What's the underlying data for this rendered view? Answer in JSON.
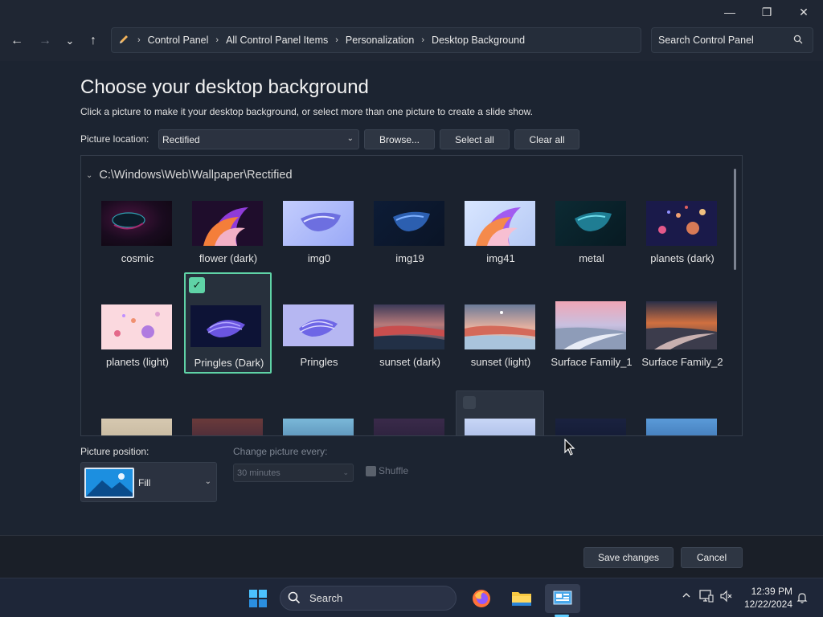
{
  "window": {
    "minimize_glyph": "—",
    "maximize_glyph": "❐",
    "close_glyph": "✕"
  },
  "nav": {
    "back_glyph": "←",
    "forward_glyph": "→",
    "recent_glyph": "⌄",
    "up_glyph": "↑",
    "breadcrumbs": [
      "Control Panel",
      "All Control Panel Items",
      "Personalization",
      "Desktop Background"
    ],
    "separator": "›",
    "dropdown_glyph": "⌄",
    "refresh_glyph": "↻",
    "search_placeholder": "Search Control Panel",
    "icons": {
      "address": "pencil-icon",
      "search": "magnifier-icon"
    }
  },
  "page": {
    "title": "Choose your desktop background",
    "description": "Click a picture to make it your desktop background, or select more than one picture to create a slide show.",
    "location_label": "Picture location:",
    "location_value": "Rectified",
    "browse_label": "Browse...",
    "select_all_label": "Select all",
    "clear_all_label": "Clear all",
    "folder_path": "C:\\Windows\\Web\\Wallpaper\\Rectified",
    "wallpapers": [
      {
        "caption": "cosmic",
        "selected": false
      },
      {
        "caption": "flower (dark)",
        "selected": false
      },
      {
        "caption": "img0",
        "selected": false
      },
      {
        "caption": "img19",
        "selected": false
      },
      {
        "caption": "img41",
        "selected": false
      },
      {
        "caption": "metal",
        "selected": false
      },
      {
        "caption": "planets (dark)",
        "selected": false
      },
      {
        "caption": "planets (light)",
        "selected": false
      },
      {
        "caption": "Pringles (Dark)",
        "selected": true
      },
      {
        "caption": "Pringles",
        "selected": false
      },
      {
        "caption": "sunset (dark)",
        "selected": false
      },
      {
        "caption": "sunset (light)",
        "selected": false
      },
      {
        "caption": "Surface Family_1",
        "selected": false
      },
      {
        "caption": "Surface Family_2",
        "selected": false
      }
    ],
    "position_label": "Picture position:",
    "position_value": "Fill",
    "change_label": "Change picture every:",
    "change_value": "30 minutes",
    "shuffle_label": "Shuffle"
  },
  "footer": {
    "save_label": "Save changes",
    "cancel_label": "Cancel"
  },
  "taskbar": {
    "search_label": "Search",
    "time": "12:39 PM",
    "date": "12/22/2024",
    "apps": [
      "start-icon",
      "firefox-icon",
      "file-explorer-icon",
      "control-panel-icon"
    ],
    "accent": "#60cdff"
  },
  "colors": {
    "selection": "#5fd3a6",
    "background": "#1c2431"
  }
}
